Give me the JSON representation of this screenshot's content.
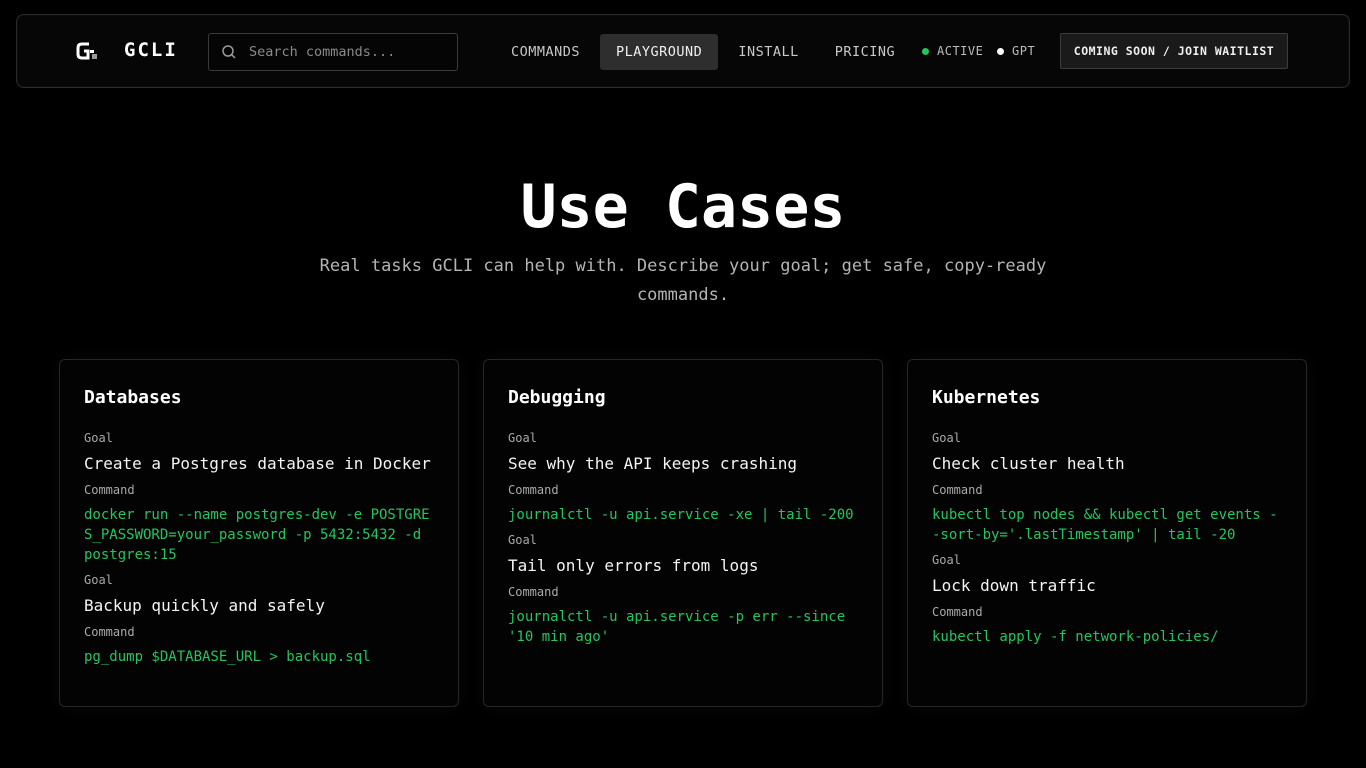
{
  "nav": {
    "brand": "GCLI",
    "search_placeholder": "Search commands...",
    "links": [
      {
        "label": "COMMANDS",
        "active": false
      },
      {
        "label": "PLAYGROUND",
        "active": true
      },
      {
        "label": "INSTALL",
        "active": false
      },
      {
        "label": "PRICING",
        "active": false
      }
    ],
    "status_active": "ACTIVE",
    "status_model": "GPT",
    "cta_label": "COMING SOON / JOIN WAITLIST"
  },
  "hero": {
    "title": "Use Cases",
    "subtitle": "Real tasks GCLI can help with. Describe your goal; get safe, copy-ready commands."
  },
  "labels": {
    "goal": "Goal",
    "command": "Command"
  },
  "cards": [
    {
      "title": "Databases",
      "entries": [
        {
          "goal": "Create a Postgres database in Docker",
          "command": "docker run --name postgres-dev -e POSTGRES_PASSWORD=your_password -p 5432:5432 -d postgres:15"
        },
        {
          "goal": "Backup quickly and safely",
          "command": "pg_dump $DATABASE_URL > backup.sql"
        }
      ]
    },
    {
      "title": "Debugging",
      "entries": [
        {
          "goal": "See why the API keeps crashing",
          "command": "journalctl -u api.service -xe | tail -200"
        },
        {
          "goal": "Tail only errors from logs",
          "command": "journalctl -u api.service -p err --since '10 min ago'"
        }
      ]
    },
    {
      "title": "Kubernetes",
      "entries": [
        {
          "goal": "Check cluster health",
          "command": "kubectl top nodes && kubectl get events --sort-by='.lastTimestamp' | tail -20"
        },
        {
          "goal": "Lock down traffic",
          "command": "kubectl apply -f network-policies/"
        }
      ]
    }
  ],
  "colors": {
    "accent_green": "#22c55e",
    "status_dot_active": "#22c55e",
    "status_dot_model": "#ffffff"
  }
}
